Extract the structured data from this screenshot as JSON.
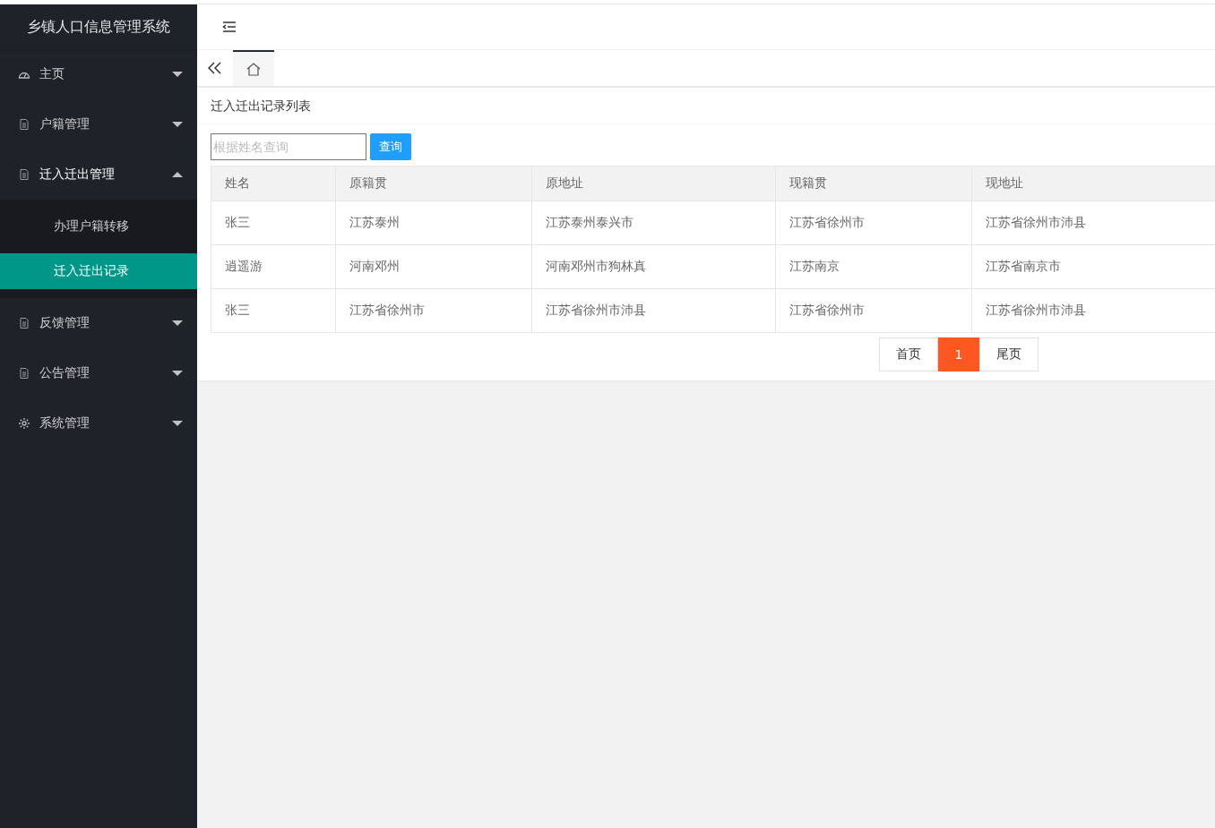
{
  "sidebar": {
    "title": "乡镇人口信息管理系统",
    "items": [
      {
        "label": "主页",
        "expanded": false
      },
      {
        "label": "户籍管理",
        "expanded": false
      },
      {
        "label": "迁入迁出管理",
        "expanded": true,
        "children": [
          {
            "label": "办理户籍转移",
            "selected": false
          },
          {
            "label": "迁入迁出记录",
            "selected": true
          }
        ]
      },
      {
        "label": "反馈管理",
        "expanded": false
      },
      {
        "label": "公告管理",
        "expanded": false
      },
      {
        "label": "系统管理",
        "expanded": false
      }
    ]
  },
  "card": {
    "title": "迁入迁出记录列表"
  },
  "search": {
    "placeholder": "根据姓名查询",
    "button": "查询"
  },
  "table": {
    "columns": [
      "姓名",
      "原籍贯",
      "原地址",
      "现籍贯",
      "现地址"
    ],
    "rows": [
      [
        "张三",
        "江苏泰州",
        "江苏泰州泰兴市",
        "江苏省徐州市",
        "江苏省徐州市沛县"
      ],
      [
        "逍遥游",
        "河南邓州",
        "河南邓州市狗林真",
        "江苏南京",
        "江苏省南京市"
      ],
      [
        "张三",
        "江苏省徐州市",
        "江苏省徐州市沛县",
        "江苏省徐州市",
        "江苏省徐州市沛县"
      ]
    ]
  },
  "pagination": {
    "first": "首页",
    "pages": [
      {
        "label": "1",
        "selected": true
      }
    ],
    "last": "尾页"
  }
}
